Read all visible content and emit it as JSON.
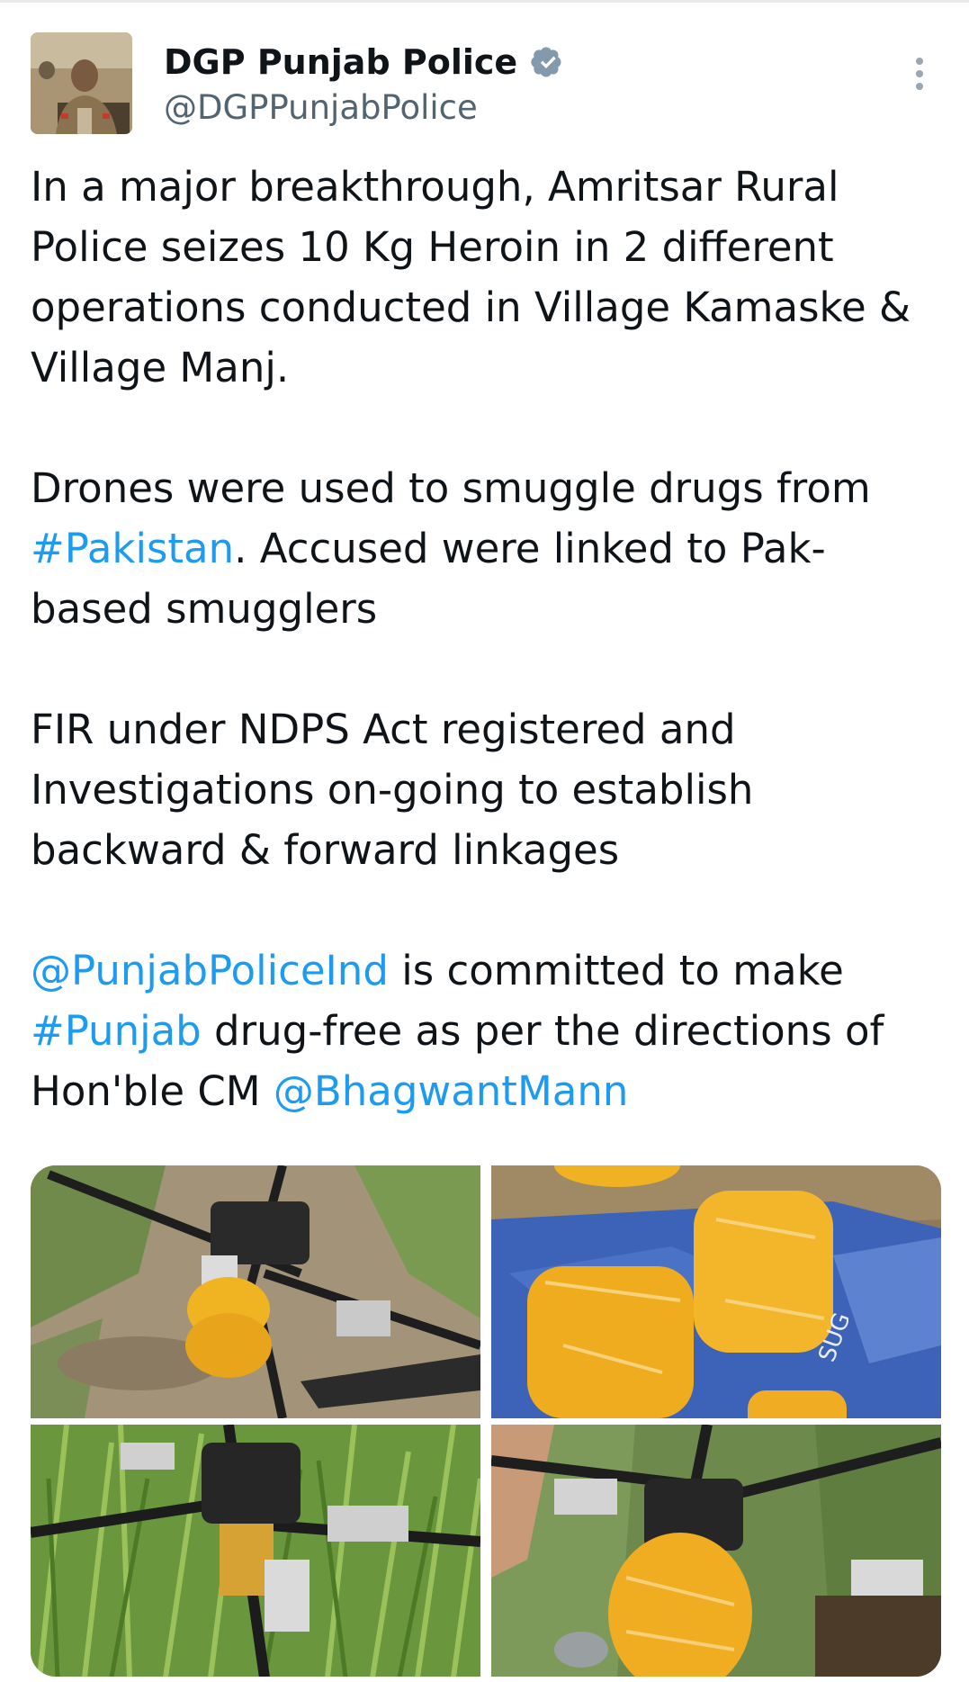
{
  "author": {
    "display_name": "DGP Punjab Police",
    "handle": "@DGPPunjabPolice",
    "verified": true,
    "avatar_icon": "officer-portrait-avatar"
  },
  "tweet": {
    "paragraph_1": "In a major breakthrough, Amritsar Rural Police seizes 10 Kg Heroin in 2 different operations conducted in Village Kamaske & Village Manj.",
    "paragraph_2": {
      "before": "Drones were used to smuggle drugs from ",
      "hashtag_pakistan": "#Pakistan",
      "after": ". Accused were linked to Pak-based smugglers"
    },
    "paragraph_3": "FIR under NDPS Act registered and Investigations on-going to establish backward & forward linkages",
    "paragraph_4": {
      "mention_punjab_police": "@PunjabPoliceInd",
      "text_1": " is committed to make ",
      "hashtag_punjab": "#Punjab",
      "text_2": " drug-free as per the directions of Hon'ble CM ",
      "mention_cm": "@BhagwantMann"
    }
  },
  "media": [
    {
      "icon": "drone-on-ground-photo"
    },
    {
      "icon": "heroin-packets-photo"
    },
    {
      "icon": "drone-in-grass-photo"
    },
    {
      "icon": "drone-with-packet-photo"
    }
  ],
  "colors": {
    "link": "#1d9bf0",
    "text": "#0f1419",
    "secondary": "#536471",
    "verified": "#829aab"
  }
}
